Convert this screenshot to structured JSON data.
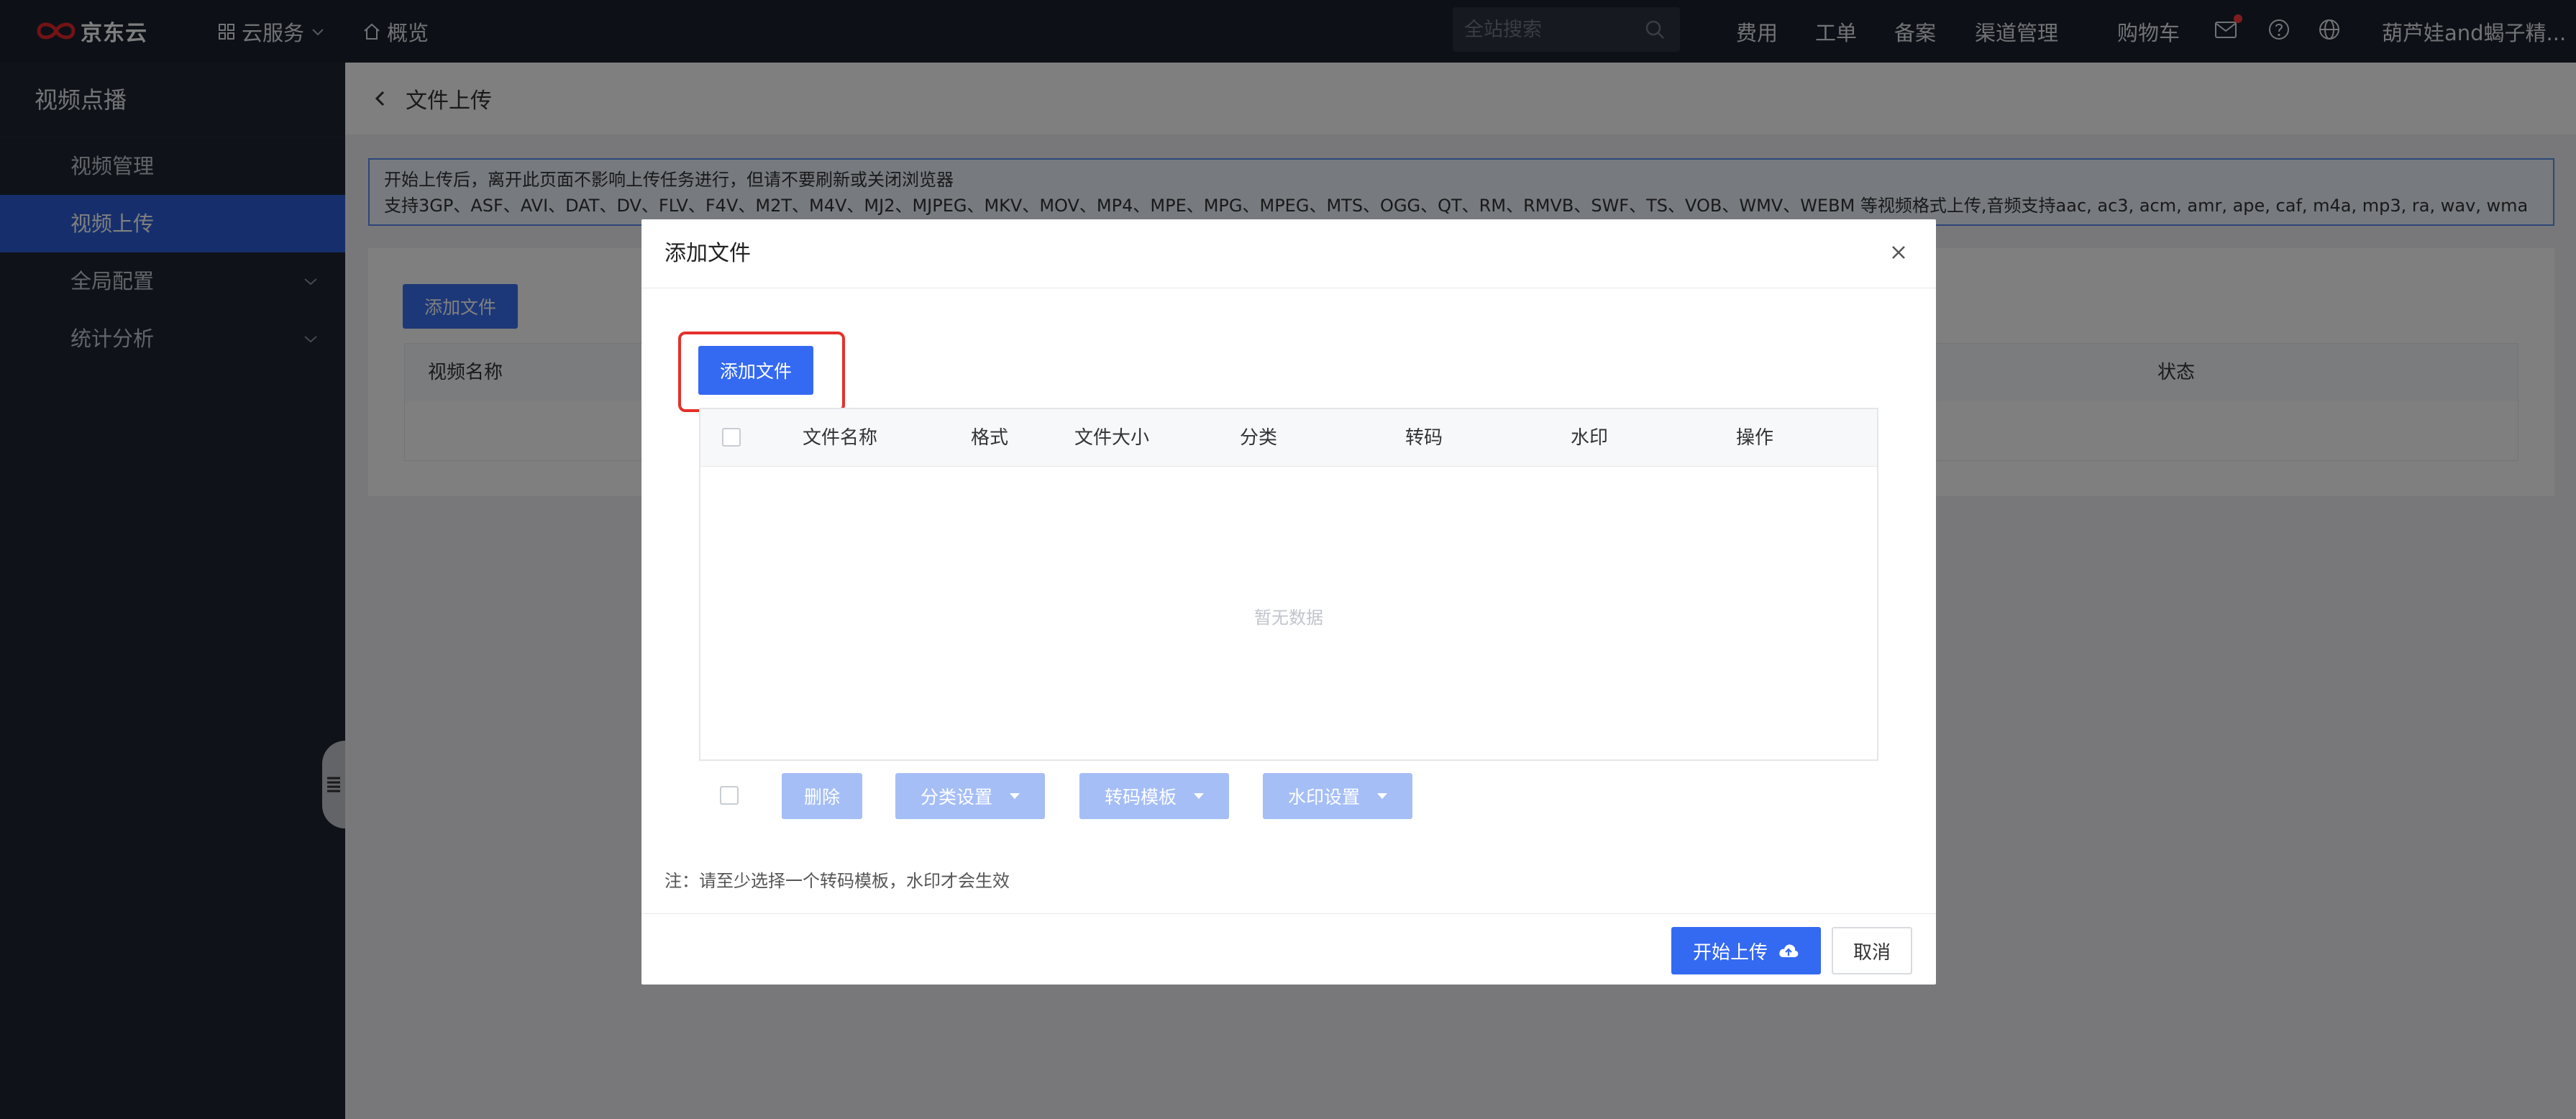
{
  "topbar": {
    "brand": "京东云",
    "cloud_services": "云服务",
    "overview": "概览",
    "search_placeholder": "全站搜索",
    "links": [
      "费用",
      "工单",
      "备案",
      "渠道管理",
      "购物车"
    ],
    "username": "葫芦娃and蝎子精..."
  },
  "sidebar": {
    "title": "视频点播",
    "items": [
      {
        "label": "视频管理"
      },
      {
        "label": "视频上传",
        "active": true
      },
      {
        "label": "全局配置"
      },
      {
        "label": "统计分析"
      }
    ]
  },
  "page": {
    "title": "文件上传",
    "notice_line1": "开始上传后，离开此页面不影响上传任务进行，但请不要刷新或关闭浏览器",
    "notice_line2": "支持3GP、ASF、AVI、DAT、DV、FLV、F4V、M2T、M4V、MJ2、MJPEG、MKV、MOV、MP4、MPE、MPG、MPEG、MTS、OGG、QT、RM、RMVB、SWF、TS、VOB、WMV、WEBM 等视频格式上传,音频支持aac, ac3, acm, amr, ape, caf, m4a, mp3, ra, wav, wma",
    "add_file": "添加文件",
    "table_headers": {
      "name": "视频名称",
      "status": "状态"
    }
  },
  "dialog": {
    "title": "添加文件",
    "add_file": "添加文件",
    "columns": [
      "文件名称",
      "格式",
      "文件大小",
      "分类",
      "转码",
      "水印",
      "操作"
    ],
    "empty_text": "暂无数据",
    "batch": {
      "delete": "删除",
      "category": "分类设置",
      "transcode": "转码模板",
      "watermark": "水印设置"
    },
    "note": "注：请至少选择一个转码模板，水印才会生效",
    "start_upload": "开始上传",
    "cancel": "取消"
  },
  "colors": {
    "accent": "#3469f2",
    "highlight": "#e5302a",
    "topbar": "#1a202e",
    "sidebar": "#1f2533"
  }
}
